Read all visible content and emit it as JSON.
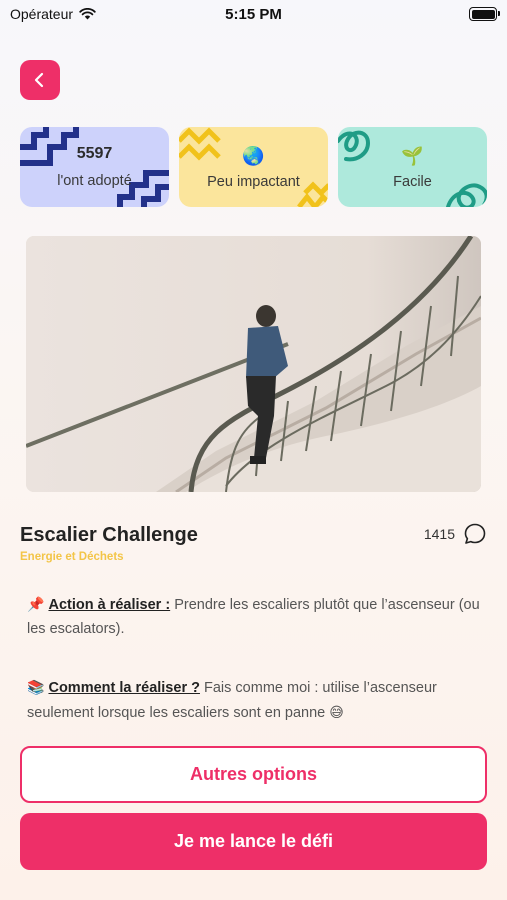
{
  "status_bar": {
    "carrier": "Opérateur",
    "time": "5:15 PM"
  },
  "stats": [
    {
      "value": "5597",
      "label": "l'ont adopté",
      "bg": "#cdd2fb",
      "deco_color": "#23318a"
    },
    {
      "emoji": "🌏",
      "label": "Peu impactant",
      "bg": "#fbe59c",
      "deco_color": "#f1c21b"
    },
    {
      "emoji": "🌱",
      "label": "Facile",
      "bg": "#aee9dc",
      "deco_color": "#1f9c86"
    }
  ],
  "challenge": {
    "title": "Escalier Challenge",
    "category": "Energie et Déchets",
    "comments_count": "1415"
  },
  "action": {
    "emoji": "📌",
    "label": "Action à réaliser :",
    "text": "Prendre les escaliers plutôt que l’ascenseur (ou les escalators)."
  },
  "how": {
    "emoji": "📚",
    "label": "Comment la réaliser ?",
    "text": "Fais comme moi : utilise l’ascenseur seulement lorsque les escaliers sont en panne",
    "end_emoji": "😅"
  },
  "buttons": {
    "other_options": "Autres options",
    "start": "Je me lance le défi"
  },
  "colors": {
    "primary": "#ee2f68",
    "category": "#f3c548"
  },
  "icons": {
    "back": "chevron-left-icon",
    "comment": "comment-bubble-icon",
    "wifi": "wifi-icon",
    "battery": "battery-icon"
  }
}
